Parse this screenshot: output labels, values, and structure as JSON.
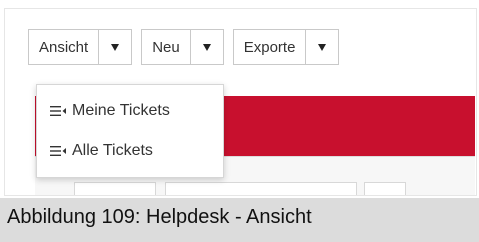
{
  "toolbar": {
    "view_label": "Ansicht",
    "new_label": "Neu",
    "export_label": "Exporte"
  },
  "view_menu": {
    "items": [
      {
        "label": "Meine Tickets",
        "icon": "list-icon"
      },
      {
        "label": "Alle Tickets",
        "icon": "list-icon"
      }
    ]
  },
  "caption": "Abbildung 109: Helpdesk - Ansicht",
  "colors": {
    "accent_band": "#c8102e",
    "caption_background": "#dcdcdc"
  }
}
